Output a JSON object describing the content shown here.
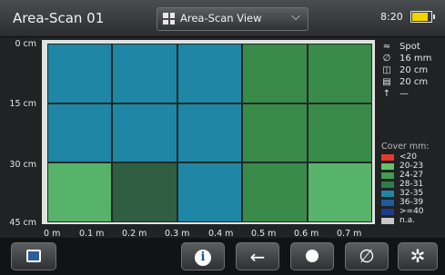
{
  "header": {
    "title": "Area-Scan 01",
    "view_label": "Area-Scan View",
    "time": "8:20",
    "battery_level": 0.85,
    "battery_color": "#f0d400"
  },
  "plot": {
    "y_labels": [
      "0 cm",
      "15 cm",
      "30 cm",
      "45 cm"
    ],
    "x_labels": [
      "0 m",
      "0.1 m",
      "0.2 m",
      "0.3 m",
      "0.4 m",
      "0.5 m",
      "0.6 m",
      "0.7 m"
    ],
    "rows": [
      [
        "#1f86a6",
        "#1f86a6",
        "#1f86a6",
        "#3a8a4a",
        "#3a8a4a"
      ],
      [
        "#1f86a6",
        "#1f86a6",
        "#1f86a6",
        "#3a8a4a",
        "#3a8a4a"
      ],
      [
        "#57b369",
        "#2f5e43",
        "#1f86a6",
        "#3a8a4a",
        "#57b369"
      ]
    ]
  },
  "settings": {
    "mode": {
      "icon": "spot-icon",
      "value": "Spot"
    },
    "diameter": {
      "icon": "diameter-icon",
      "value": "16 mm"
    },
    "spacing_vertical": {
      "icon": "vertical-spacing-icon",
      "value": "20 cm"
    },
    "spacing_horizontal": {
      "icon": "horizontal-spacing-icon",
      "value": "20 cm"
    },
    "depth": {
      "icon": "up-arrow-icon",
      "value": "—"
    }
  },
  "legend": {
    "title": "Cover mm:",
    "items": [
      {
        "label": "<20",
        "color": "#e23b2e"
      },
      {
        "label": "20-23",
        "color": "#63c36b"
      },
      {
        "label": "24-27",
        "color": "#3f9e4d"
      },
      {
        "label": "28-31",
        "color": "#2f7d4a"
      },
      {
        "label": "32-35",
        "color": "#1f86a6"
      },
      {
        "label": "36-39",
        "color": "#1d5d9c"
      },
      {
        "label": ">=40",
        "color": "#1a3c8a"
      },
      {
        "label": "n.a.",
        "color": "#c8c8c8"
      }
    ]
  },
  "footer": {
    "buttons": [
      {
        "name": "fullscreen-button",
        "icon": "expand-icon"
      },
      {
        "name": "info-button",
        "icon": "info-icon",
        "label": "i"
      },
      {
        "name": "back-button",
        "icon": "left-arrow-icon",
        "label": "←"
      },
      {
        "name": "record-button",
        "icon": "dot-icon"
      },
      {
        "name": "diameter-button",
        "icon": "diameter-icon",
        "label": "∅"
      },
      {
        "name": "settings-button",
        "icon": "gear-icon",
        "label": "✲"
      }
    ]
  }
}
